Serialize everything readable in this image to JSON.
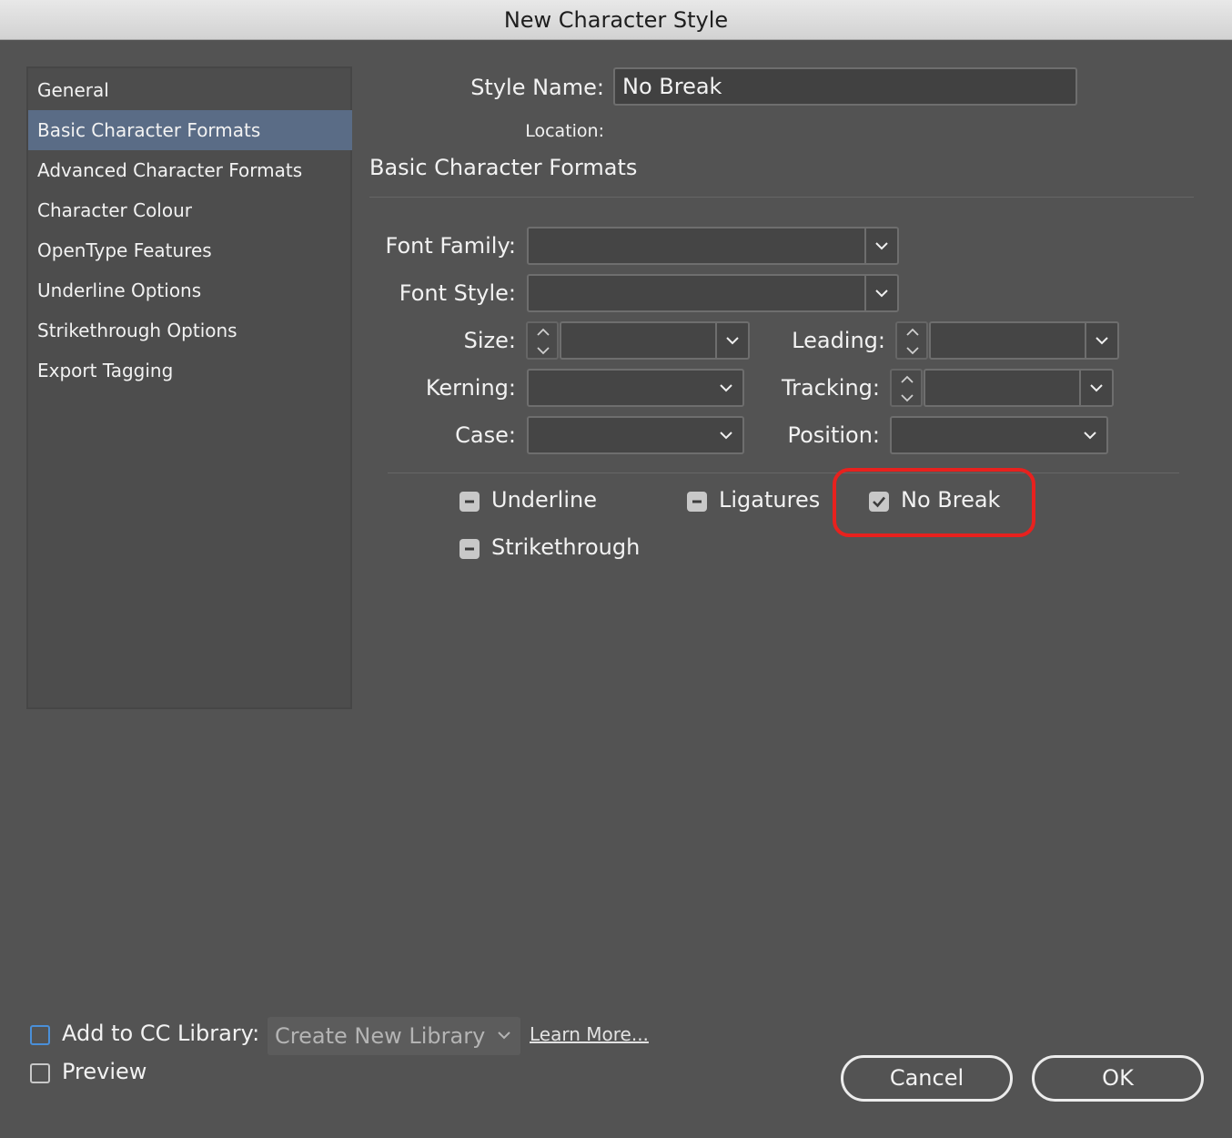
{
  "window": {
    "title": "New Character Style"
  },
  "sidebar": {
    "items": [
      {
        "label": "General",
        "selected": false
      },
      {
        "label": "Basic Character Formats",
        "selected": true
      },
      {
        "label": "Advanced Character Formats",
        "selected": false
      },
      {
        "label": "Character Colour",
        "selected": false
      },
      {
        "label": "OpenType Features",
        "selected": false
      },
      {
        "label": "Underline Options",
        "selected": false
      },
      {
        "label": "Strikethrough Options",
        "selected": false
      },
      {
        "label": "Export Tagging",
        "selected": false
      }
    ]
  },
  "header": {
    "style_name_label": "Style Name:",
    "style_name_value": "No Break",
    "location_label": "Location:",
    "location_value": ""
  },
  "section": {
    "title": "Basic Character Formats"
  },
  "fields": {
    "font_family": {
      "label": "Font Family:",
      "value": ""
    },
    "font_style": {
      "label": "Font Style:",
      "value": ""
    },
    "size": {
      "label": "Size:",
      "value": ""
    },
    "leading": {
      "label": "Leading:",
      "value": ""
    },
    "kerning": {
      "label": "Kerning:",
      "value": ""
    },
    "tracking": {
      "label": "Tracking:",
      "value": ""
    },
    "case": {
      "label": "Case:",
      "value": ""
    },
    "position": {
      "label": "Position:",
      "value": ""
    }
  },
  "checkboxes": {
    "underline": {
      "label": "Underline",
      "state": "indeterminate"
    },
    "ligatures": {
      "label": "Ligatures",
      "state": "indeterminate"
    },
    "no_break": {
      "label": "No Break",
      "state": "checked"
    },
    "strikethrough": {
      "label": "Strikethrough",
      "state": "indeterminate"
    }
  },
  "annotation": {
    "highlight_color": "#e8211e"
  },
  "footer": {
    "cc_library_label": "Add to CC Library:",
    "cc_library_checked": false,
    "library_select_value": "Create New Library",
    "learn_more": "Learn More...",
    "preview_label": "Preview",
    "preview_checked": false
  },
  "buttons": {
    "cancel": "Cancel",
    "ok": "OK"
  },
  "colors": {
    "background": "#535353",
    "selected_item": "#5a6c86",
    "accent_focus": "#4a8fd8"
  }
}
